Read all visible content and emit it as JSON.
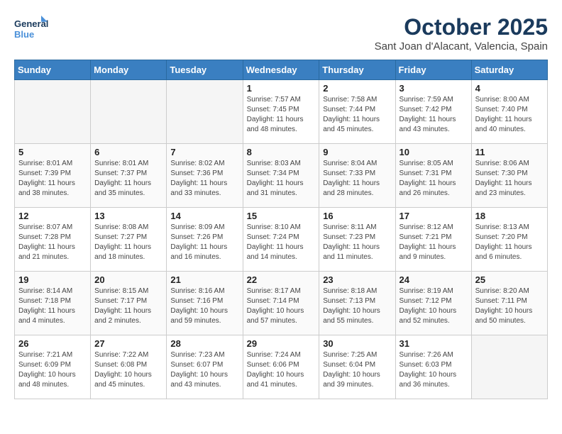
{
  "header": {
    "logo_line1": "General",
    "logo_line2": "Blue",
    "month": "October 2025",
    "location": "Sant Joan d'Alacant, Valencia, Spain"
  },
  "weekdays": [
    "Sunday",
    "Monday",
    "Tuesday",
    "Wednesday",
    "Thursday",
    "Friday",
    "Saturday"
  ],
  "weeks": [
    [
      {
        "day": "",
        "info": ""
      },
      {
        "day": "",
        "info": ""
      },
      {
        "day": "",
        "info": ""
      },
      {
        "day": "1",
        "info": "Sunrise: 7:57 AM\nSunset: 7:45 PM\nDaylight: 11 hours and 48 minutes."
      },
      {
        "day": "2",
        "info": "Sunrise: 7:58 AM\nSunset: 7:44 PM\nDaylight: 11 hours and 45 minutes."
      },
      {
        "day": "3",
        "info": "Sunrise: 7:59 AM\nSunset: 7:42 PM\nDaylight: 11 hours and 43 minutes."
      },
      {
        "day": "4",
        "info": "Sunrise: 8:00 AM\nSunset: 7:40 PM\nDaylight: 11 hours and 40 minutes."
      }
    ],
    [
      {
        "day": "5",
        "info": "Sunrise: 8:01 AM\nSunset: 7:39 PM\nDaylight: 11 hours and 38 minutes."
      },
      {
        "day": "6",
        "info": "Sunrise: 8:01 AM\nSunset: 7:37 PM\nDaylight: 11 hours and 35 minutes."
      },
      {
        "day": "7",
        "info": "Sunrise: 8:02 AM\nSunset: 7:36 PM\nDaylight: 11 hours and 33 minutes."
      },
      {
        "day": "8",
        "info": "Sunrise: 8:03 AM\nSunset: 7:34 PM\nDaylight: 11 hours and 31 minutes."
      },
      {
        "day": "9",
        "info": "Sunrise: 8:04 AM\nSunset: 7:33 PM\nDaylight: 11 hours and 28 minutes."
      },
      {
        "day": "10",
        "info": "Sunrise: 8:05 AM\nSunset: 7:31 PM\nDaylight: 11 hours and 26 minutes."
      },
      {
        "day": "11",
        "info": "Sunrise: 8:06 AM\nSunset: 7:30 PM\nDaylight: 11 hours and 23 minutes."
      }
    ],
    [
      {
        "day": "12",
        "info": "Sunrise: 8:07 AM\nSunset: 7:28 PM\nDaylight: 11 hours and 21 minutes."
      },
      {
        "day": "13",
        "info": "Sunrise: 8:08 AM\nSunset: 7:27 PM\nDaylight: 11 hours and 18 minutes."
      },
      {
        "day": "14",
        "info": "Sunrise: 8:09 AM\nSunset: 7:26 PM\nDaylight: 11 hours and 16 minutes."
      },
      {
        "day": "15",
        "info": "Sunrise: 8:10 AM\nSunset: 7:24 PM\nDaylight: 11 hours and 14 minutes."
      },
      {
        "day": "16",
        "info": "Sunrise: 8:11 AM\nSunset: 7:23 PM\nDaylight: 11 hours and 11 minutes."
      },
      {
        "day": "17",
        "info": "Sunrise: 8:12 AM\nSunset: 7:21 PM\nDaylight: 11 hours and 9 minutes."
      },
      {
        "day": "18",
        "info": "Sunrise: 8:13 AM\nSunset: 7:20 PM\nDaylight: 11 hours and 6 minutes."
      }
    ],
    [
      {
        "day": "19",
        "info": "Sunrise: 8:14 AM\nSunset: 7:18 PM\nDaylight: 11 hours and 4 minutes."
      },
      {
        "day": "20",
        "info": "Sunrise: 8:15 AM\nSunset: 7:17 PM\nDaylight: 11 hours and 2 minutes."
      },
      {
        "day": "21",
        "info": "Sunrise: 8:16 AM\nSunset: 7:16 PM\nDaylight: 10 hours and 59 minutes."
      },
      {
        "day": "22",
        "info": "Sunrise: 8:17 AM\nSunset: 7:14 PM\nDaylight: 10 hours and 57 minutes."
      },
      {
        "day": "23",
        "info": "Sunrise: 8:18 AM\nSunset: 7:13 PM\nDaylight: 10 hours and 55 minutes."
      },
      {
        "day": "24",
        "info": "Sunrise: 8:19 AM\nSunset: 7:12 PM\nDaylight: 10 hours and 52 minutes."
      },
      {
        "day": "25",
        "info": "Sunrise: 8:20 AM\nSunset: 7:11 PM\nDaylight: 10 hours and 50 minutes."
      }
    ],
    [
      {
        "day": "26",
        "info": "Sunrise: 7:21 AM\nSunset: 6:09 PM\nDaylight: 10 hours and 48 minutes."
      },
      {
        "day": "27",
        "info": "Sunrise: 7:22 AM\nSunset: 6:08 PM\nDaylight: 10 hours and 45 minutes."
      },
      {
        "day": "28",
        "info": "Sunrise: 7:23 AM\nSunset: 6:07 PM\nDaylight: 10 hours and 43 minutes."
      },
      {
        "day": "29",
        "info": "Sunrise: 7:24 AM\nSunset: 6:06 PM\nDaylight: 10 hours and 41 minutes."
      },
      {
        "day": "30",
        "info": "Sunrise: 7:25 AM\nSunset: 6:04 PM\nDaylight: 10 hours and 39 minutes."
      },
      {
        "day": "31",
        "info": "Sunrise: 7:26 AM\nSunset: 6:03 PM\nDaylight: 10 hours and 36 minutes."
      },
      {
        "day": "",
        "info": ""
      }
    ]
  ]
}
